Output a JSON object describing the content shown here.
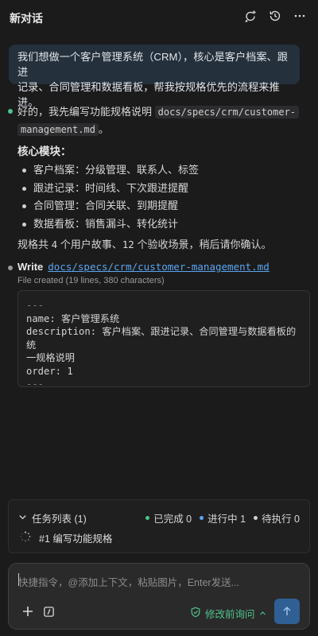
{
  "header": {
    "title": "新对话",
    "icons": [
      "new-chat-icon",
      "history-icon",
      "more-icon"
    ]
  },
  "user_message": {
    "line1": "我们想做一个客户管理系统（CRM），核心是客户档案、跟进",
    "line2": "记录、合同管理和数据看板，帮我按规格优先的流程来推进。"
  },
  "assistant": {
    "intro_prefix": "好的，我先编写功能规格说明",
    "intro_path_part1": "docs/specs/crm/customer-",
    "intro_path_part2": "management.md",
    "intro_suffix": "。",
    "modules_heading": "核心模块：",
    "modules": [
      "客户档案：分级管理、联系人、标签",
      "跟进记录：时间线、下次跟进提醒",
      "合同管理：合同关联、到期提醒",
      "数据看板：销售漏斗、转化统计"
    ],
    "summary_a": "规格共 ",
    "summary_n1": "4",
    "summary_b": " 个用户故事、",
    "summary_n2": "12",
    "summary_c": " 个验收场景，稍后请你确认。"
  },
  "write_tool": {
    "label": "Write",
    "path": "docs/specs/crm/customer-management.md",
    "status": "File created (19 lines, 380 characters)",
    "code": {
      "sep_top": "---",
      "name_line": "name: 客户管理系统",
      "desc_line1": "description: 客户档案、跟进记录、合同管理与数据看板的统",
      "desc_line2": "一规格说明",
      "order_line": "order: 1",
      "sep_bottom": "---"
    }
  },
  "tasks": {
    "title": "任务列表 (1)",
    "done": "已完成 0",
    "in_progress": "进行中 1",
    "pending": "待执行 0",
    "items": [
      "#1 编写功能规格"
    ],
    "colors": {
      "done": "#4fc38a",
      "in_progress": "#5aa6f0",
      "pending": "#d0d0d0"
    }
  },
  "composer": {
    "placeholder": "快捷指令，@添加上下文，粘贴图片，Enter发送...",
    "mode_label": "修改前询问",
    "accent": "#4fc38a",
    "send_color": "#2f5f93"
  }
}
